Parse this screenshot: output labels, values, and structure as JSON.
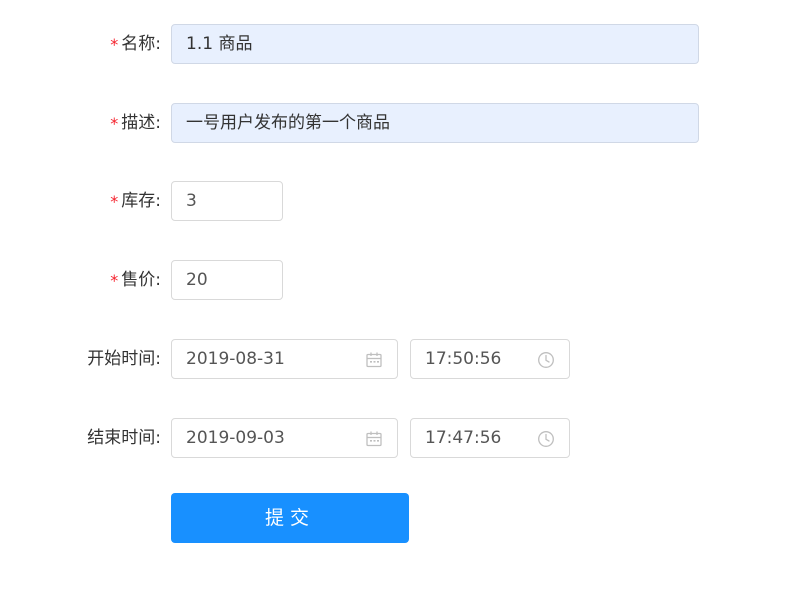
{
  "form": {
    "name": {
      "label": "名称:",
      "required_mark": "*",
      "value": "1.1 商品"
    },
    "description": {
      "label": "描述:",
      "required_mark": "*",
      "value": "一号用户发布的第一个商品"
    },
    "stock": {
      "label": "库存:",
      "required_mark": "*",
      "value": "3"
    },
    "price": {
      "label": "售价:",
      "required_mark": "*",
      "value": "20"
    },
    "start_time": {
      "label": "开始时间:",
      "date": "2019-08-31",
      "time": "17:50:56"
    },
    "end_time": {
      "label": "结束时间:",
      "date": "2019-09-03",
      "time": "17:47:56"
    },
    "submit_label": "提交"
  },
  "icons": {
    "date": "calendar-icon",
    "time": "clock-icon"
  },
  "colors": {
    "primary": "#1890ff",
    "required": "#f5222d",
    "autofill_background": "#e8f0fe",
    "border": "#d9d9d9"
  }
}
